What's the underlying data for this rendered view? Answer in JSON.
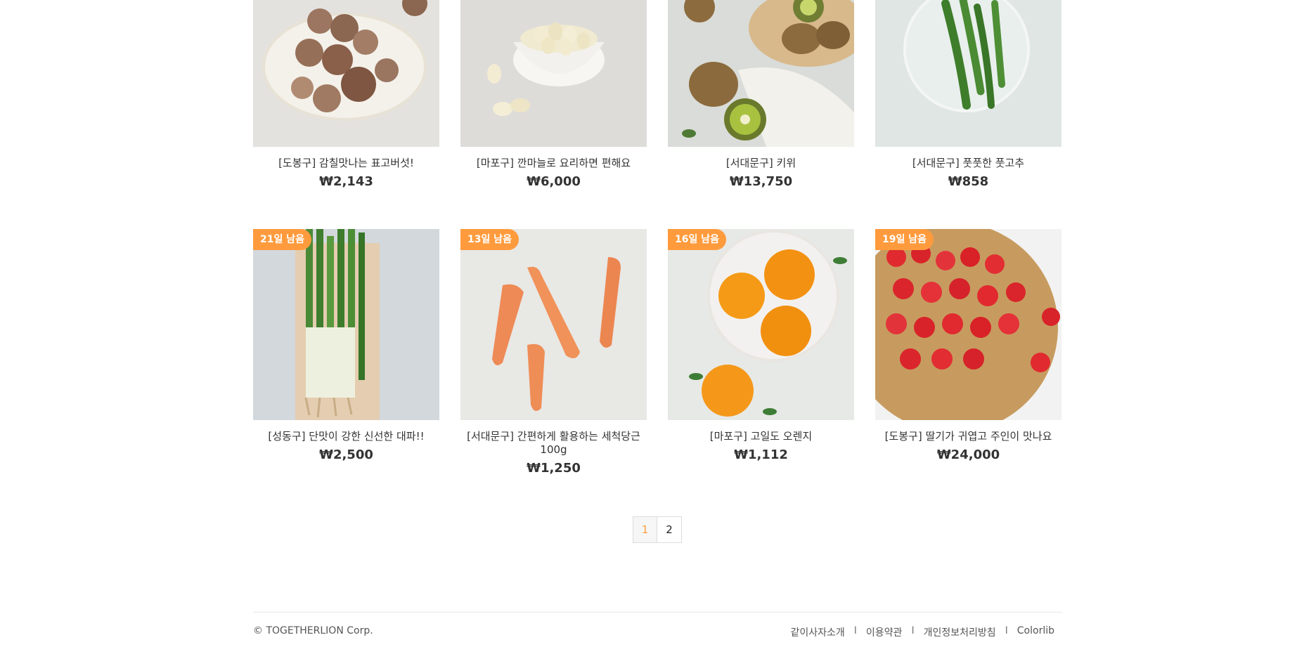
{
  "products_top": [
    {
      "name": "[도봉구] 감칠맛나는 표고버섯!",
      "price": "₩2,143",
      "image": "shiitake-mushrooms"
    },
    {
      "name": "[마포구] 깐마늘로 요리하면 편해요",
      "price": "₩6,000",
      "image": "peeled-garlic"
    },
    {
      "name": "[서대문구] 키위",
      "price": "₩13,750",
      "image": "kiwi"
    },
    {
      "name": "[서대문구] 풋풋한 풋고추",
      "price": "₩858",
      "image": "green-chili"
    }
  ],
  "products_bottom": [
    {
      "badge": "21일 남음",
      "name": "[성동구] 단맛이 강한 신선한 대파!!",
      "price": "₩2,500",
      "image": "green-onion"
    },
    {
      "badge": "13일 남음",
      "name": "[서대문구] 간편하게 활용하는 세척당근 100g",
      "price": "₩1,250",
      "image": "carrots"
    },
    {
      "badge": "16일 남음",
      "name": "[마포구] 고일도 오렌지",
      "price": "₩1,112",
      "image": "oranges"
    },
    {
      "badge": "19일 남음",
      "name": "[도봉구] 딸기가 귀엽고 주인이 맛나요",
      "price": "₩24,000",
      "image": "strawberries"
    }
  ],
  "pagination": {
    "pages": [
      "1",
      "2"
    ],
    "current": "1"
  },
  "footer": {
    "copyright": "© TOGETHERLION Corp.",
    "links": [
      "같이사자소개",
      "이용약관",
      "개인정보처리방침",
      "Colorlib"
    ],
    "separator": "I"
  },
  "colors": {
    "accent": "#ff9b3d"
  }
}
